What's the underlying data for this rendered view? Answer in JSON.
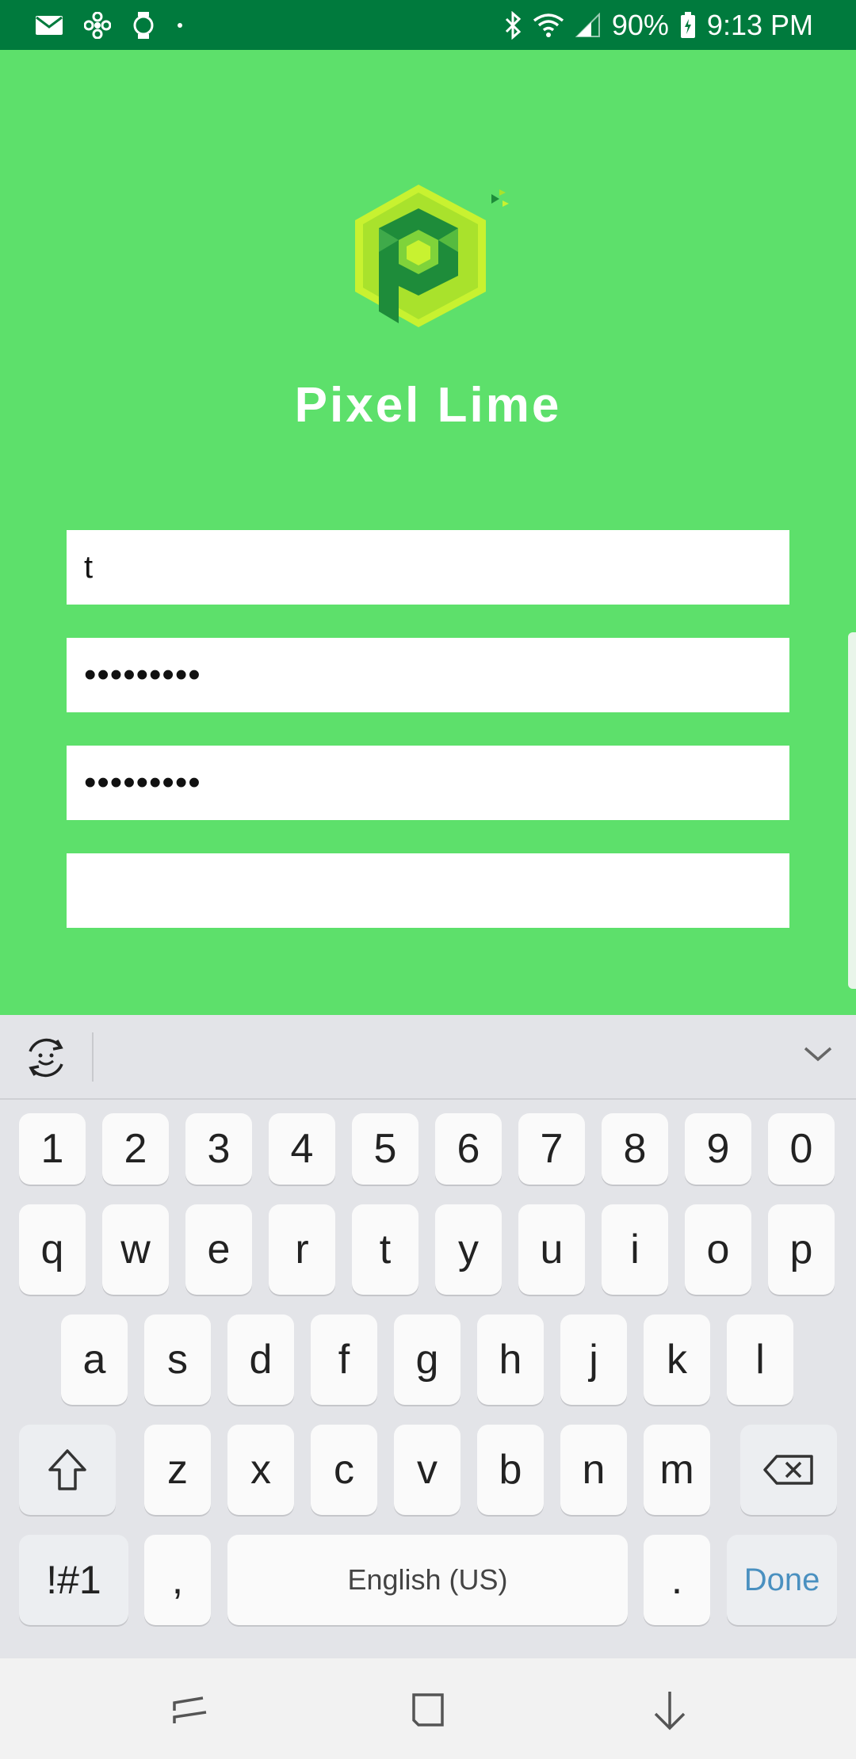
{
  "status_bar": {
    "battery": "90%",
    "time": "9:13 PM",
    "icons": [
      "mail-icon",
      "fan-icon",
      "watch-icon",
      "dot-icon",
      "bluetooth-icon",
      "wifi-icon",
      "signal-icon",
      "battery-icon"
    ]
  },
  "app": {
    "brand_name": "Pixel Lime",
    "colors": {
      "background": "#5de06b",
      "status_bar": "#007a3d",
      "logo_lime": "#c8f230",
      "logo_dark": "#1e8c3a"
    },
    "fields": [
      {
        "name": "username-field",
        "value": "t",
        "type": "text"
      },
      {
        "name": "password-field",
        "value": "•••••••••",
        "type": "password"
      },
      {
        "name": "confirm-password-field",
        "value": "•••••••••",
        "type": "password"
      },
      {
        "name": "extra-field",
        "value": "",
        "type": "text"
      }
    ]
  },
  "keyboard": {
    "number_row": [
      "1",
      "2",
      "3",
      "4",
      "5",
      "6",
      "7",
      "8",
      "9",
      "0"
    ],
    "row1": [
      "q",
      "w",
      "e",
      "r",
      "t",
      "y",
      "u",
      "i",
      "o",
      "p"
    ],
    "row2": [
      "a",
      "s",
      "d",
      "f",
      "g",
      "h",
      "j",
      "k",
      "l"
    ],
    "row3": [
      "z",
      "x",
      "c",
      "v",
      "b",
      "n",
      "m"
    ],
    "symbols_key": "!#1",
    "comma_key": ",",
    "space_label": "English (US)",
    "period_key": ".",
    "done_label": "Done"
  },
  "nav_bar": {
    "icons": [
      "recents-icon",
      "home-icon",
      "back-icon"
    ]
  }
}
